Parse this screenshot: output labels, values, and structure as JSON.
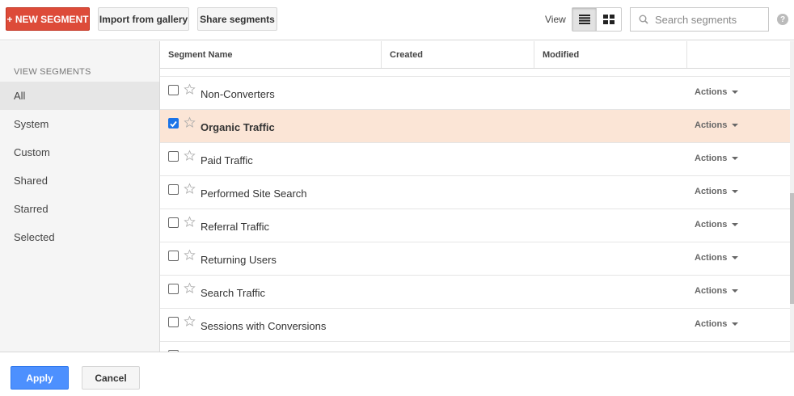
{
  "toolbar": {
    "new_segment_label": "+ NEW SEGMENT",
    "import_label": "Import from gallery",
    "share_label": "Share segments",
    "view_label": "View",
    "search_placeholder": "Search segments",
    "help_label": "?"
  },
  "sidebar": {
    "title": "VIEW SEGMENTS",
    "items": [
      {
        "label": "All",
        "active": true
      },
      {
        "label": "System",
        "active": false
      },
      {
        "label": "Custom",
        "active": false
      },
      {
        "label": "Shared",
        "active": false
      },
      {
        "label": "Starred",
        "active": false
      },
      {
        "label": "Selected",
        "active": false
      }
    ]
  },
  "table": {
    "columns": [
      "Segment Name",
      "Created",
      "Modified"
    ],
    "actions_label": "Actions",
    "rows": [
      {
        "name": "Non-Converters",
        "checked": false
      },
      {
        "name": "Organic Traffic",
        "checked": true
      },
      {
        "name": "Paid Traffic",
        "checked": false
      },
      {
        "name": "Performed Site Search",
        "checked": false
      },
      {
        "name": "Referral Traffic",
        "checked": false
      },
      {
        "name": "Returning Users",
        "checked": false
      },
      {
        "name": "Search Traffic",
        "checked": false
      },
      {
        "name": "Sessions with Conversions",
        "checked": false
      }
    ]
  },
  "footer": {
    "apply_label": "Apply",
    "cancel_label": "Cancel"
  },
  "colors": {
    "new_segment": "#dd4b39",
    "apply": "#4d90fe",
    "selected_row": "#fbe5d6",
    "checkbox_checked": "#1a73e8"
  }
}
